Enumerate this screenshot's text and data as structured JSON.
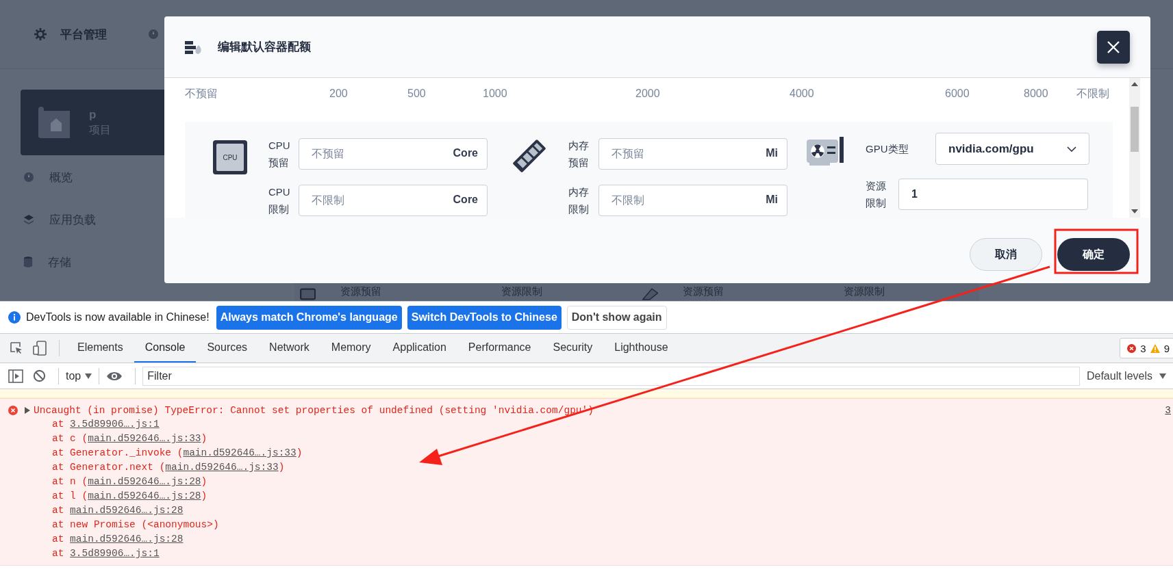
{
  "app": {
    "header": {
      "title": "平台管理"
    },
    "project": {
      "name": "p",
      "type": "项目"
    },
    "nav": [
      {
        "label": "概览",
        "kind": "gauge"
      },
      {
        "label": "应用负载",
        "kind": "layers"
      },
      {
        "label": "存储",
        "kind": "database"
      }
    ],
    "background_labels": [
      "资源预留",
      "资源限制",
      "资源预留",
      "资源限制"
    ]
  },
  "dialog": {
    "title": "编辑默认容器配额",
    "scale_marks": [
      "不预留",
      "200",
      "500",
      "1000",
      "2000",
      "4000",
      "6000",
      "8000",
      "不限制"
    ],
    "groups": [
      {
        "kind": "cpu",
        "icon_label": "CPU",
        "fields": [
          {
            "label": "CPU 预留",
            "placeholder": "不预留",
            "unit": "Core"
          },
          {
            "label": "CPU 限制",
            "placeholder": "不限制",
            "unit": "Core"
          }
        ]
      },
      {
        "kind": "memory",
        "fields": [
          {
            "label": "内存预留",
            "placeholder": "不预留",
            "unit": "Mi"
          },
          {
            "label": "内存限制",
            "placeholder": "不限制",
            "unit": "Mi"
          }
        ]
      },
      {
        "kind": "gpu",
        "fields": [
          {
            "label": "GPU类型",
            "kind": "select",
            "value": "nvidia.com/gpu"
          },
          {
            "label": "资源限制",
            "kind": "input",
            "value": "1"
          }
        ]
      }
    ],
    "buttons": [
      {
        "label": "取消",
        "kind": "secondary"
      },
      {
        "label": "确定",
        "kind": "primary"
      }
    ]
  },
  "devtools": {
    "infobar": {
      "text": "DevTools is now available in Chinese!",
      "buttons": [
        {
          "label": "Always match Chrome's language",
          "kind": "primary"
        },
        {
          "label": "Switch DevTools to Chinese",
          "kind": "primary"
        },
        {
          "label": "Don't show again",
          "kind": "secondary"
        }
      ]
    },
    "tabs": [
      {
        "label": "Elements",
        "selected": false
      },
      {
        "label": "Console",
        "selected": true
      },
      {
        "label": "Sources",
        "selected": false
      },
      {
        "label": "Network",
        "selected": false
      },
      {
        "label": "Memory",
        "selected": false
      },
      {
        "label": "Application",
        "selected": false
      },
      {
        "label": "Performance",
        "selected": false
      },
      {
        "label": "Security",
        "selected": false
      },
      {
        "label": "Lighthouse",
        "selected": false
      }
    ],
    "issues": {
      "errors": "3",
      "warnings": "9"
    },
    "toolbar": {
      "context": "top",
      "filter_placeholder": "Filter",
      "levels": "Default levels"
    },
    "error": {
      "message": "Uncaught (in promise) TypeError: Cannot set properties of undefined (setting 'nvidia.com/gpu')",
      "source": "3",
      "stack": [
        {
          "prefix": "at ",
          "link": "3.5d89906….js:1"
        },
        {
          "prefix": "at c (",
          "link": "main.d592646….js:33",
          "suffix": ")"
        },
        {
          "prefix": "at Generator._invoke (",
          "link": "main.d592646….js:33",
          "suffix": ")"
        },
        {
          "prefix": "at Generator.next (",
          "link": "main.d592646….js:33",
          "suffix": ")"
        },
        {
          "prefix": "at n (",
          "link": "main.d592646….js:28",
          "suffix": ")"
        },
        {
          "prefix": "at l (",
          "link": "main.d592646….js:28",
          "suffix": ")"
        },
        {
          "prefix": "at ",
          "link": "main.d592646….js:28"
        },
        {
          "prefix": "at new Promise (<anonymous>)"
        },
        {
          "prefix": "at ",
          "link": "main.d592646….js:28"
        },
        {
          "prefix": "at ",
          "link": "3.5d89906….js:1"
        }
      ]
    }
  }
}
